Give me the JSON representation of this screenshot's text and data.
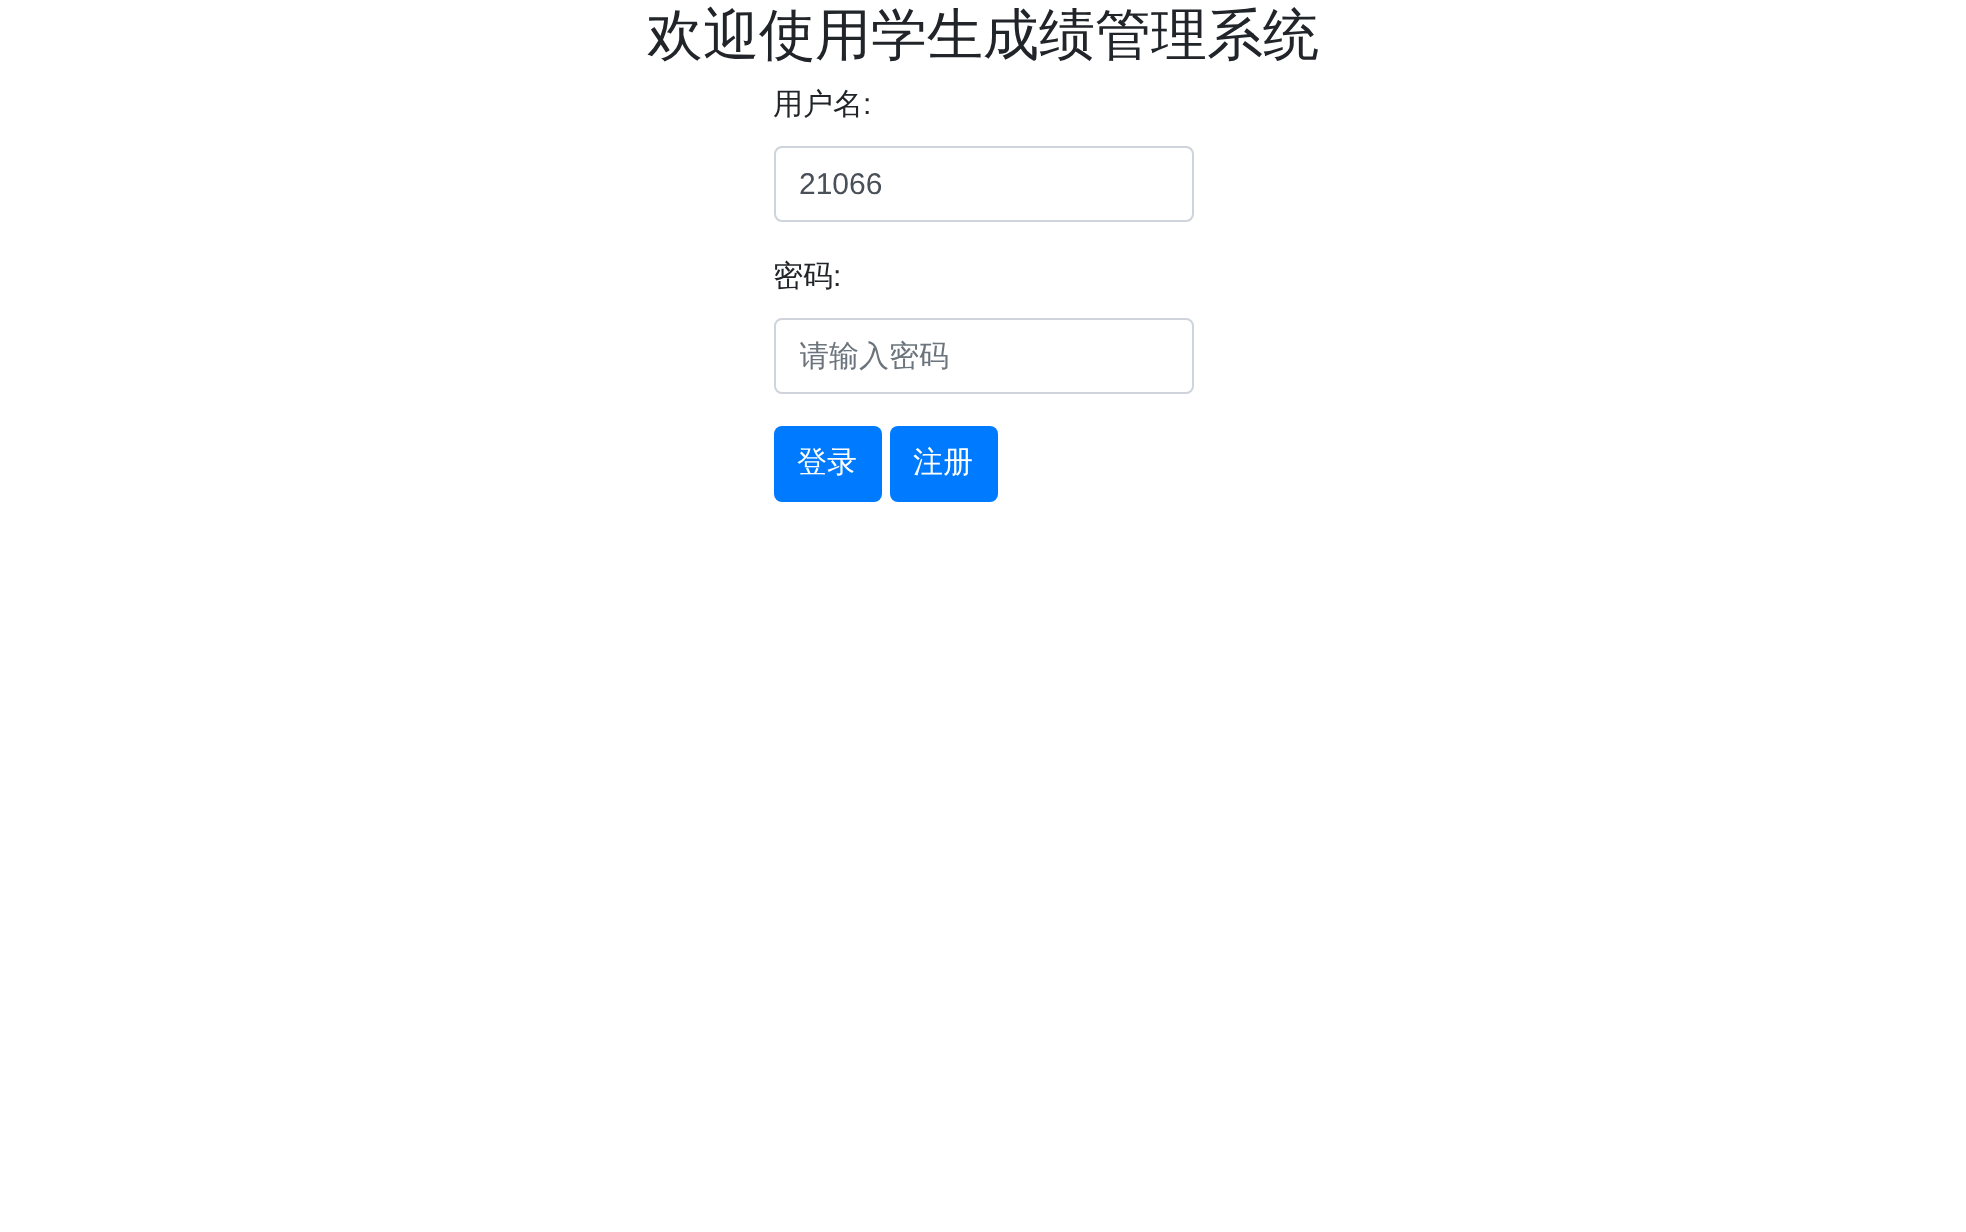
{
  "title": "欢迎使用学生成绩管理系统",
  "fields": [
    {
      "label": "用户名:",
      "value": "21066"
    },
    {
      "label": "密码:",
      "placeholder": "请输入密码"
    }
  ],
  "buttons": [
    "登录",
    "注册"
  ]
}
